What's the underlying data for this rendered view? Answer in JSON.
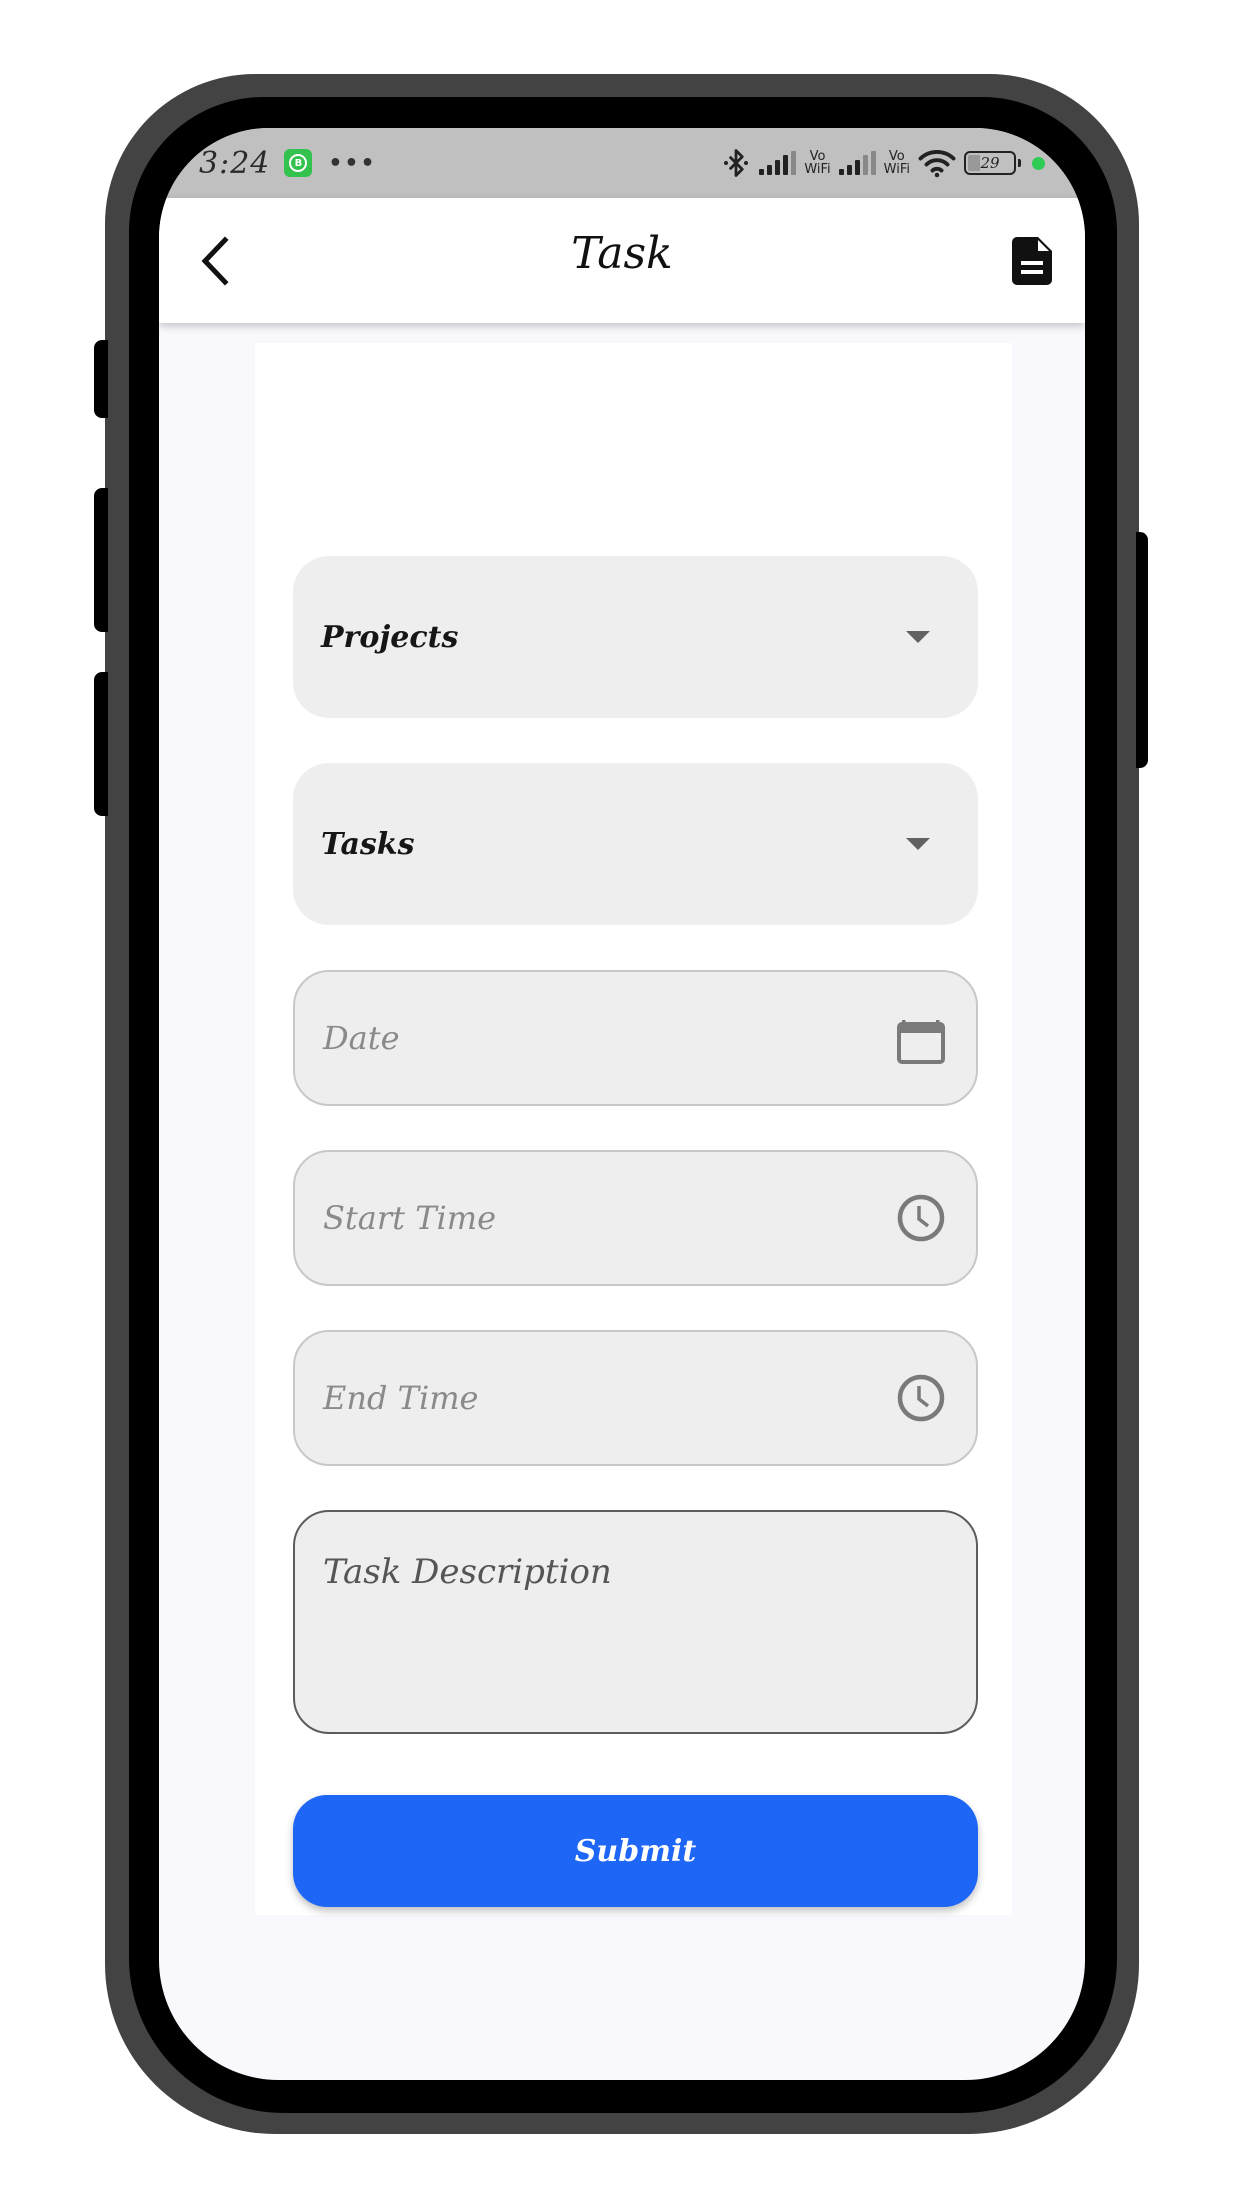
{
  "status_bar": {
    "time": "3:24",
    "app_icon": "whatsapp-business-icon",
    "app_icon_letter": "B",
    "more": "•••",
    "icons": [
      "bluetooth-icon",
      "signal-icon",
      "vowifi-icon",
      "signal-icon",
      "vowifi-icon",
      "wifi-icon",
      "battery-icon"
    ],
    "vowifi_top": "Vo",
    "vowifi_bottom": "WiFi",
    "battery_level": "29",
    "indicator_color": "#2ecc55"
  },
  "app_bar": {
    "title": "Task",
    "back_icon": "chevron-left-icon",
    "action_icon": "document-icon"
  },
  "form": {
    "projects": {
      "label": "Projects",
      "icon": "dropdown-caret-icon"
    },
    "tasks": {
      "label": "Tasks",
      "icon": "dropdown-caret-icon"
    },
    "date": {
      "placeholder": "Date",
      "icon": "calendar-icon"
    },
    "start_time": {
      "placeholder": "Start Time",
      "icon": "clock-icon"
    },
    "end_time": {
      "placeholder": "End Time",
      "icon": "clock-icon"
    },
    "description": {
      "placeholder": "Task Description"
    },
    "submit_label": "Submit"
  },
  "colors": {
    "accent": "#1e66f5",
    "field_bg": "#eeeeee",
    "status_bar_bg": "#c0c0c0",
    "screen_bg": "#f9f9fd"
  }
}
